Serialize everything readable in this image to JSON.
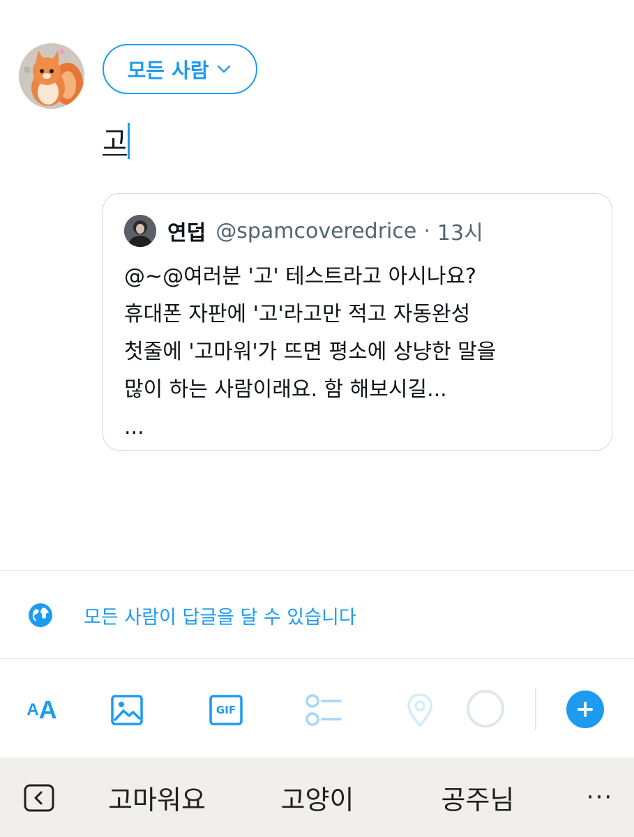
{
  "composer": {
    "audience_label": "모든 사람",
    "typed_text": "고"
  },
  "quote": {
    "name": "연덥",
    "handle": "@spamcoveredrice",
    "separator": "·",
    "time": "13시",
    "lines": [
      "@~@여러분 '고' 테스트라고 아시나요?",
      "휴대폰 자판에 '고'라고만 적고 자동완성",
      "첫줄에 '고마워'가 뜨면 평소에 상냥한 말을",
      "많이 하는 사람이래요. 함 해보시길...",
      "..."
    ]
  },
  "reply_setting": {
    "label": "모든 사람이 답글을 달 수 있습니다"
  },
  "toolbar": {
    "text_size_label_small": "A",
    "text_size_label_large": "A",
    "gif_label": "GIF"
  },
  "keyboard": {
    "suggestions": [
      "고마워요",
      "고양이",
      "공주님"
    ],
    "more": "···"
  },
  "colors": {
    "accent": "#1d9bf0",
    "text": "#0f1419",
    "muted": "#536471",
    "border": "#cfd9de",
    "keyboard_bg": "#f1efeb"
  }
}
